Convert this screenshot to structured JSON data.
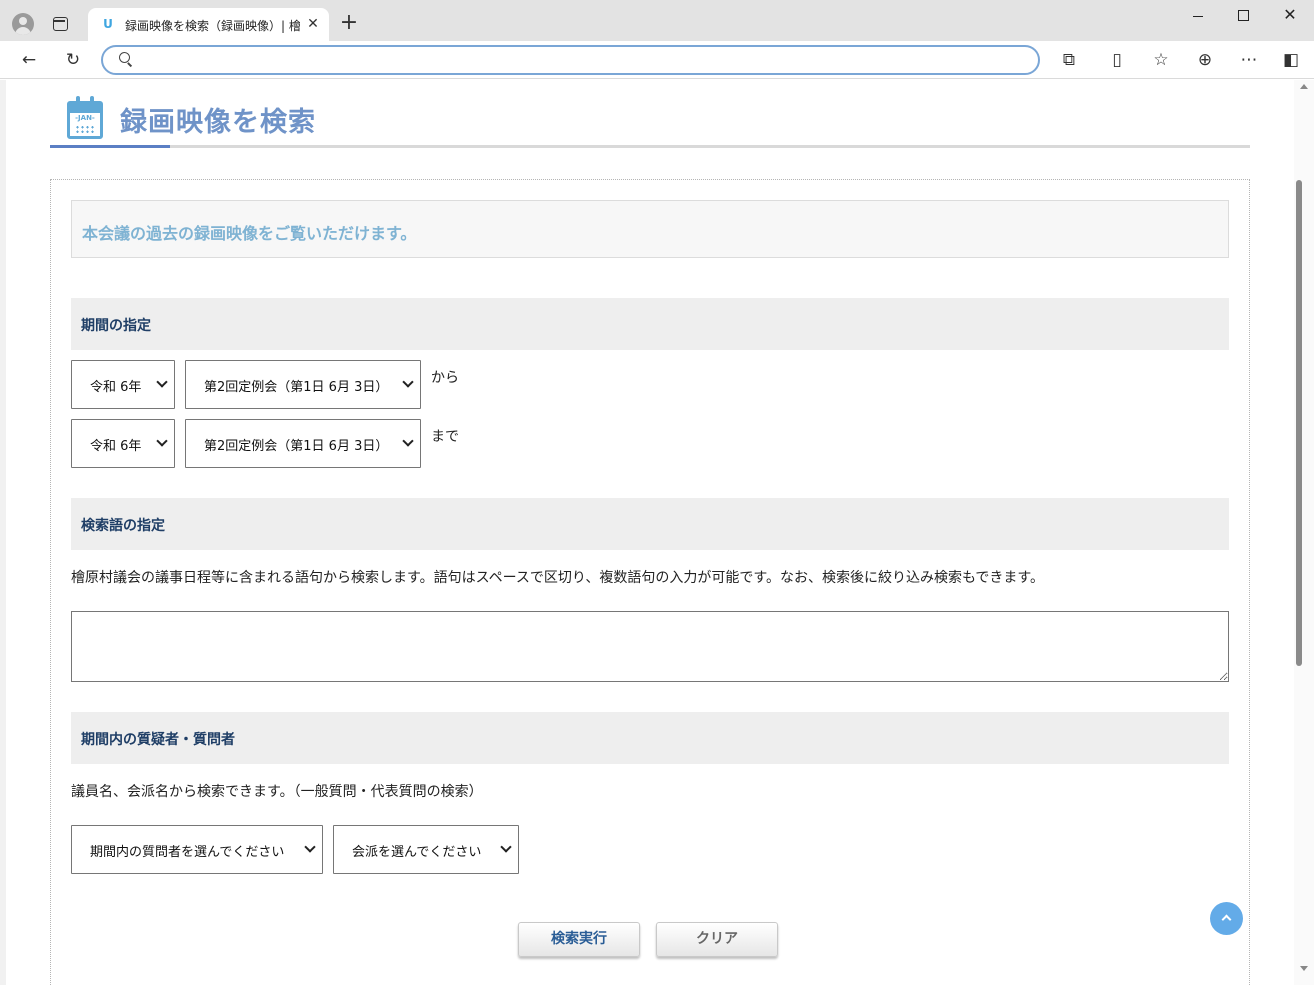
{
  "browser": {
    "tab_title": "録画映像を検索（録画映像）| 檜",
    "tab_favicon": "U",
    "address_value": "",
    "address_placeholder": ""
  },
  "icons": [
    "profile-icon",
    "tab-actions-icon",
    "close-icon",
    "new-tab-icon",
    "minimize-icon",
    "maximize-icon",
    "window-close-icon",
    "back-icon",
    "reload-icon",
    "search-icon",
    "extensions-icon",
    "split-screen-icon",
    "favorites-icon",
    "collections-icon",
    "more-icon",
    "sidebar-icon",
    "calendar-icon",
    "back-to-top-icon"
  ],
  "colors": {
    "title": "#6f93c8",
    "intro": "#7fb3d3",
    "section_heading": "#1f3e66",
    "accent_underline": "#5b7fc4",
    "back_to_top": "#63abe8"
  },
  "page": {
    "title": "録画映像を検索",
    "calendar_label": "-JAN-",
    "intro": "本会議の過去の録画映像をご覧いただけます。"
  },
  "period": {
    "heading": "期間の指定",
    "from": {
      "era_year": "令和 6年",
      "session": "第2回定例会（第1日 6月 3日）",
      "suffix": "から"
    },
    "to": {
      "era_year": "令和 6年",
      "session": "第2回定例会（第1日 6月 3日）",
      "suffix": "まで"
    }
  },
  "keyword": {
    "heading": "検索語の指定",
    "description": "檜原村議会の議事日程等に含まれる語句から検索します。語句はスペースで区切り、複数語句の入力が可能です。なお、検索後に絞り込み検索もできます。",
    "value": ""
  },
  "questioner": {
    "heading": "期間内の質疑者・質問者",
    "description": "議員名、会派名から検索できます。（一般質問・代表質問の検索）",
    "member_select": "期間内の質問者を選んでください",
    "faction_select": "会派を選んでください"
  },
  "buttons": {
    "search": "検索実行",
    "clear": "クリア"
  }
}
